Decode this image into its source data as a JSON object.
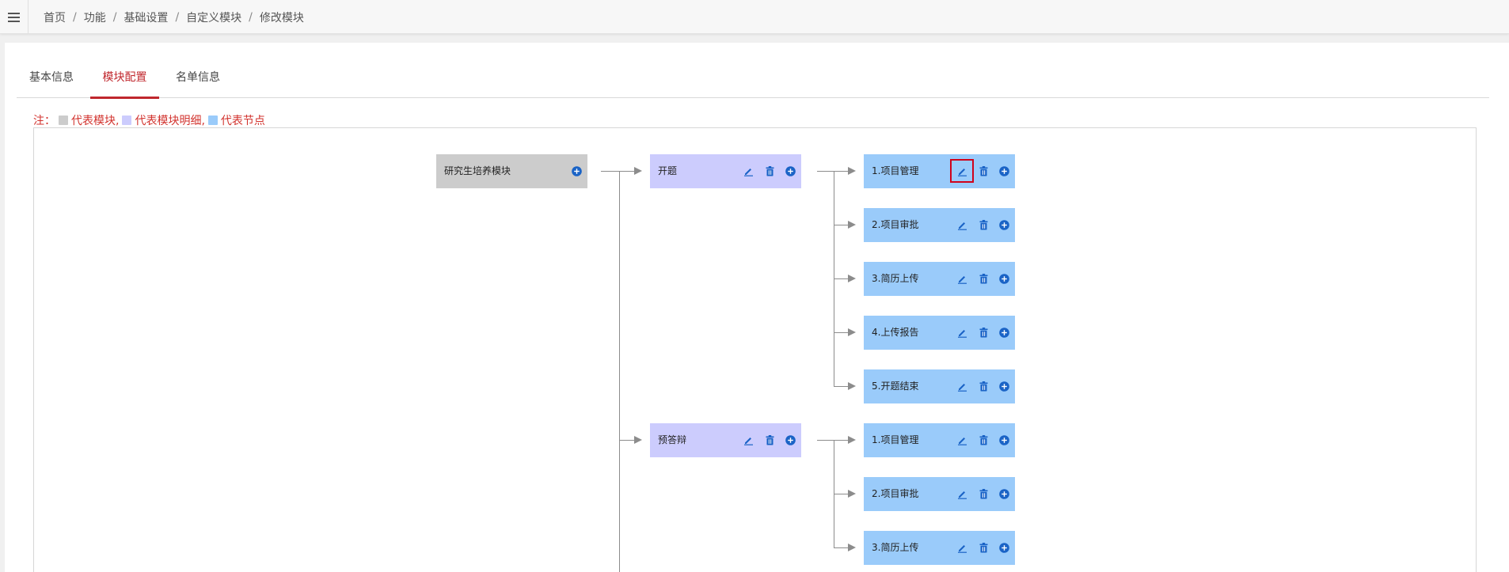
{
  "breadcrumb": [
    "首页",
    "功能",
    "基础设置",
    "自定义模块",
    "修改模块"
  ],
  "breadcrumb_sep": "/",
  "tabs": [
    {
      "label": "基本信息",
      "active": false
    },
    {
      "label": "模块配置",
      "active": true
    },
    {
      "label": "名单信息",
      "active": false
    }
  ],
  "legend": {
    "prefix": "注：",
    "module": "代表模块,",
    "detail": "代表模块明细,",
    "point": "代表节点"
  },
  "colors": {
    "module": "#cccccc",
    "detail": "#ccccfd",
    "point": "#9acbfa",
    "accent": "#c0272d",
    "icon": "#1a63c6"
  },
  "tree": {
    "root": "研究生培养模块",
    "details": [
      {
        "label": "开题",
        "points": [
          "1.项目管理",
          "2.项目审批",
          "3.简历上传",
          "4.上传报告",
          "5.开题结束"
        ]
      },
      {
        "label": "预答辩",
        "points": [
          "1.项目管理",
          "2.项目审批",
          "3.简历上传"
        ]
      }
    ]
  }
}
